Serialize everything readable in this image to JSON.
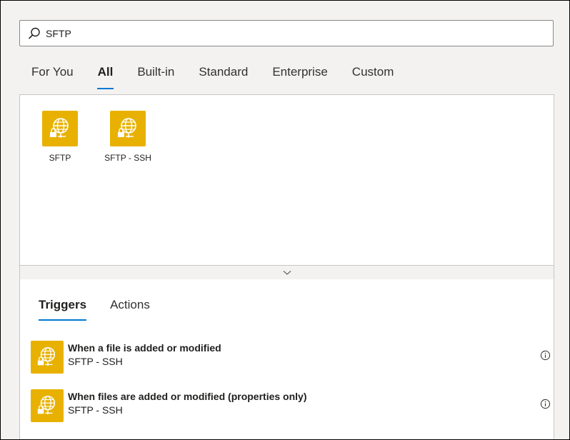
{
  "search": {
    "value": "SFTP"
  },
  "tabs": [
    {
      "label": "For You"
    },
    {
      "label": "All"
    },
    {
      "label": "Built-in"
    },
    {
      "label": "Standard"
    },
    {
      "label": "Enterprise"
    },
    {
      "label": "Custom"
    }
  ],
  "active_tab": "All",
  "connectors": [
    {
      "label": "SFTP",
      "icon": "sftp-globe-lock-icon"
    },
    {
      "label": "SFTP - SSH",
      "icon": "sftp-ssh-globe-lock-icon"
    }
  ],
  "sub_tabs": [
    {
      "label": "Triggers"
    },
    {
      "label": "Actions"
    }
  ],
  "active_sub_tab": "Triggers",
  "operations": [
    {
      "title": "When a file is added or modified",
      "connector": "SFTP - SSH"
    },
    {
      "title": "When files are added or modified (properties only)",
      "connector": "SFTP - SSH"
    }
  ],
  "colors": {
    "accent": "#0078d4",
    "tile": "#e8b100",
    "background": "#f3f2f1"
  }
}
